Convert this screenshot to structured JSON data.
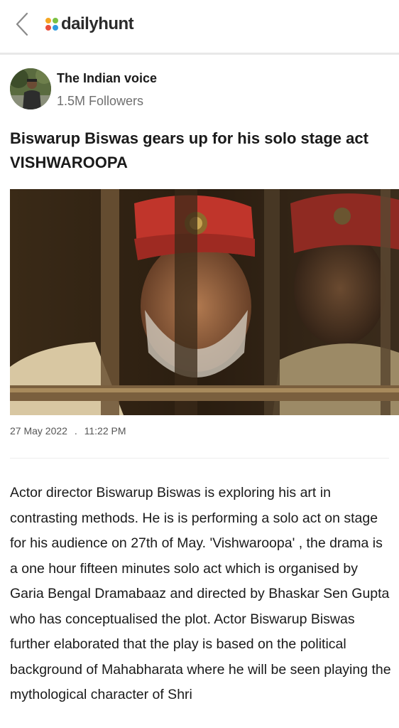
{
  "app": {
    "logo_text": "dailyhunt",
    "logo_dot_colors": [
      "#f5a623",
      "#7ac143",
      "#e94e3c",
      "#2f9be0"
    ],
    "back_icon": "chevron-left-icon"
  },
  "author": {
    "name": "The Indian voice",
    "followers": "1.5M Followers"
  },
  "article": {
    "headline": "Biswarup Biswas gears up for his solo stage act VISHWAROOPA",
    "date": "27 May 2022",
    "separator": ".",
    "time": "11:22 PM",
    "body": "Actor director Biswarup Biswas is exploring his art in contrasting methods. He is is performing a solo act on stage for his audience on 27th of May. 'Vishwaroopa' , the drama is a one hour fifteen minutes solo act which is organised by Garia Bengal Dramabaaz and directed by Bhaskar Sen Gupta who has conceptualised the plot.  Actor Biswarup Biswas further elaborated that the play is based on the political background of Mahabharata where  he will be seen playing the mythological character of Shri"
  }
}
